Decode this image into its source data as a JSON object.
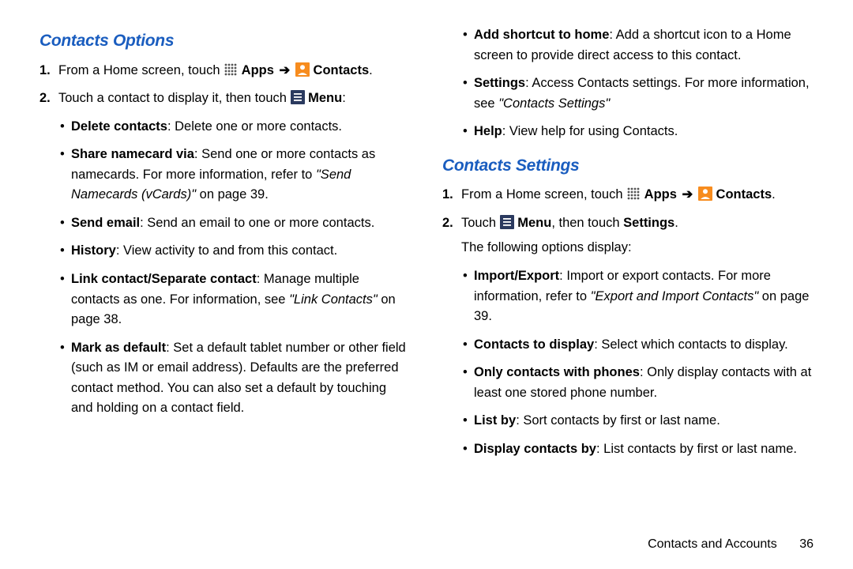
{
  "left": {
    "heading": "Contacts Options",
    "step1_a": "From a Home screen, touch ",
    "step1_apps": "Apps",
    "step1_contacts": "Contacts",
    "step1_end": ".",
    "step2_a": "Touch a contact to display it, then touch ",
    "step2_menu": "Menu",
    "step2_end": ":",
    "bul1_b": "Delete contacts",
    "bul1_t": ": Delete one or more contacts.",
    "bul2_b": "Share namecard via",
    "bul2_t1": ": Send one or more contacts as namecards. For more information, refer to ",
    "bul2_i": "\"Send Namecards (vCards)\"",
    "bul2_t2": " on page 39.",
    "bul3_b": "Send email",
    "bul3_t": ": Send an email to one or more contacts.",
    "bul4_b": "History",
    "bul4_t": ": View activity to and from this contact.",
    "bul5_b": "Link contact/Separate contact",
    "bul5_t1": ": Manage multiple contacts as one. For information, see ",
    "bul5_i": "\"Link Contacts\"",
    "bul5_t2": " on page 38.",
    "bul6_b": "Mark as default",
    "bul6_t": ": Set a default tablet number or other field (such as IM or email address). Defaults are the preferred contact method. You can also set a default by touching and holding on a contact field."
  },
  "right_top": {
    "bul1_b": "Add shortcut to home",
    "bul1_t": ": Add a shortcut icon to a Home screen to provide direct access to this contact.",
    "bul2_b": "Settings",
    "bul2_t1": ": Access Contacts settings. For more information, see ",
    "bul2_i": "\"Contacts Settings\"",
    "bul3_b": "Help",
    "bul3_t": ": View help for using Contacts."
  },
  "right": {
    "heading": "Contacts Settings",
    "step1_a": "From a Home screen, touch ",
    "step1_apps": "Apps",
    "step1_contacts": "Contacts",
    "step1_end": ".",
    "step2_a": "Touch ",
    "step2_menu": "Menu",
    "step2_mid": ", then touch ",
    "step2_settings": "Settings",
    "step2_end": ".",
    "step2_line2": "The following options display:",
    "bul1_b": "Import/Export",
    "bul1_t1": ": Import or export contacts. For more information, refer to ",
    "bul1_i": "\"Export and Import Contacts\"",
    "bul1_t2": " on page 39.",
    "bul2_b": "Contacts to display",
    "bul2_t": ": Select which contacts to display.",
    "bul3_b": "Only contacts with phones",
    "bul3_t": ": Only display contacts with at least one stored phone number.",
    "bul4_b": "List by",
    "bul4_t": ": Sort contacts by first or last name.",
    "bul5_b": "Display contacts by",
    "bul5_t": ": List contacts by first or last name."
  },
  "footer": {
    "section": "Contacts and Accounts",
    "page": "36"
  },
  "numbers": {
    "one": "1.",
    "two": "2."
  }
}
